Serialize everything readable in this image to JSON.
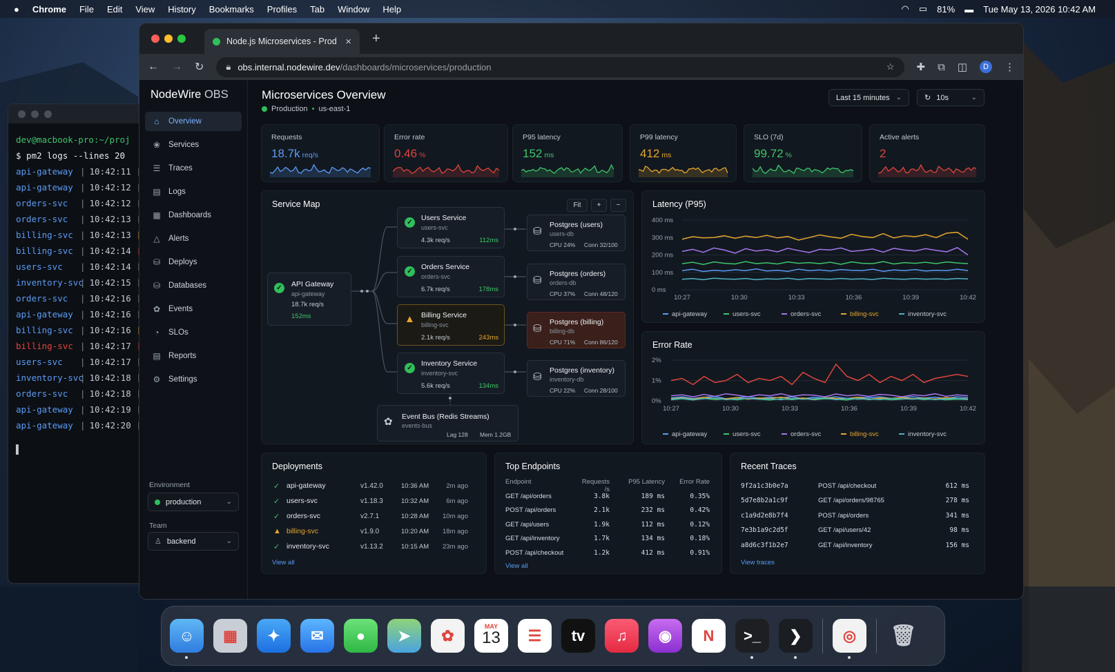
{
  "menubar": {
    "apple": "",
    "app": "Chrome",
    "items": [
      "File",
      "Edit",
      "View",
      "History",
      "Bookmarks",
      "Profiles",
      "Tab",
      "Window",
      "Help"
    ],
    "battery": "81%",
    "datetime": "Tue May 13, 2026  10:42 AM"
  },
  "terminal": {
    "prompt": "dev@macbook-pro:~/proj",
    "command": "$ pm2 logs --lines 20",
    "lines": [
      {
        "svc": "api-gateway",
        "time": "10:42:11",
        "level": "[info",
        "color": "#5b9cf5",
        "lc": "#9aa3ae"
      },
      {
        "svc": "api-gateway",
        "time": "10:42:12",
        "level": "[info",
        "color": "#5b9cf5",
        "lc": "#9aa3ae"
      },
      {
        "svc": "orders-svc",
        "time": "10:42:12",
        "level": "[info",
        "color": "#5b9cf5",
        "lc": "#9aa3ae"
      },
      {
        "svc": "orders-svc",
        "time": "10:42:13",
        "level": "[info",
        "color": "#5b9cf5",
        "lc": "#9aa3ae"
      },
      {
        "svc": "billing-svc",
        "time": "10:42:13",
        "level": "[warn",
        "color": "#5b9cf5",
        "lc": "#e5a72e"
      },
      {
        "svc": "billing-svc",
        "time": "10:42:14",
        "level": "[erro",
        "color": "#5b9cf5",
        "lc": "#e0453d"
      },
      {
        "svc": "users-svc",
        "time": "10:42:14",
        "level": "[info",
        "color": "#5b9cf5",
        "lc": "#9aa3ae"
      },
      {
        "svc": "inventory-svc",
        "time": "10:42:15",
        "level": "[info",
        "color": "#5b9cf5",
        "lc": "#9aa3ae"
      },
      {
        "svc": "orders-svc",
        "time": "10:42:16",
        "level": "[info",
        "color": "#5b9cf5",
        "lc": "#9aa3ae"
      },
      {
        "svc": "api-gateway",
        "time": "10:42:16",
        "level": "[info",
        "color": "#5b9cf5",
        "lc": "#9aa3ae"
      },
      {
        "svc": "billing-svc",
        "time": "10:42:16",
        "level": "[warn",
        "color": "#5b9cf5",
        "lc": "#e5a72e"
      },
      {
        "svc": "billing-svc",
        "time": "10:42:17",
        "level": "[erro",
        "color": "#e0453d",
        "lc": "#e0453d"
      },
      {
        "svc": "users-svc",
        "time": "10:42:17",
        "level": "[info",
        "color": "#5b9cf5",
        "lc": "#9aa3ae"
      },
      {
        "svc": "inventory-svc",
        "time": "10:42:18",
        "level": "[info",
        "color": "#5b9cf5",
        "lc": "#9aa3ae"
      },
      {
        "svc": "orders-svc",
        "time": "10:42:18",
        "level": "[info",
        "color": "#5b9cf5",
        "lc": "#9aa3ae"
      },
      {
        "svc": "api-gateway",
        "time": "10:42:19",
        "level": "[info",
        "color": "#5b9cf5",
        "lc": "#9aa3ae"
      },
      {
        "svc": "api-gateway",
        "time": "10:42:20",
        "level": "[info",
        "color": "#5b9cf5",
        "lc": "#9aa3ae"
      }
    ],
    "cursor": "▌"
  },
  "browser": {
    "tab_title": "Node.js Microservices - Prod",
    "url_host": "obs.internal.nodewire.dev",
    "url_path": "/dashboards/microservices/production",
    "avatar": "D"
  },
  "sidebar": {
    "brand_a": "NodeWire",
    "brand_b": " OBS",
    "items": [
      {
        "label": "Overview",
        "icon": "⌂"
      },
      {
        "label": "Services",
        "icon": "❀"
      },
      {
        "label": "Traces",
        "icon": "☰"
      },
      {
        "label": "Logs",
        "icon": "▤"
      },
      {
        "label": "Dashboards",
        "icon": "▦"
      },
      {
        "label": "Alerts",
        "icon": "△"
      },
      {
        "label": "Deploys",
        "icon": "⛁"
      },
      {
        "label": "Databases",
        "icon": "⛁"
      },
      {
        "label": "Events",
        "icon": "✿"
      },
      {
        "label": "SLOs",
        "icon": "◔"
      },
      {
        "label": "Reports",
        "icon": "▤"
      },
      {
        "label": "Settings",
        "icon": "⚙"
      }
    ],
    "env_label": "Environment",
    "env_value": "production",
    "team_label": "Team",
    "team_value": "backend"
  },
  "header": {
    "title": "Microservices Overview",
    "env": "Production",
    "region": "us-east-1",
    "range": "Last 15 minutes",
    "refresh": "10s"
  },
  "kpis": [
    {
      "label": "Requests",
      "value": "18.7k",
      "unit": "req/s",
      "color": "#5b9cf5"
    },
    {
      "label": "Error rate",
      "value": "0.46",
      "unit": "%",
      "color": "#e0453d"
    },
    {
      "label": "P95 latency",
      "value": "152",
      "unit": "ms",
      "color": "#3fc56a"
    },
    {
      "label": "P99 latency",
      "value": "412",
      "unit": "ms",
      "color": "#e5a72e"
    },
    {
      "label": "SLO (7d)",
      "value": "99.72",
      "unit": "%",
      "color": "#3fc56a"
    },
    {
      "label": "Active alerts",
      "value": "2",
      "unit": "",
      "color": "#e0453d"
    }
  ],
  "service_map": {
    "title": "Service Map",
    "fit": "Fit",
    "zoom_in": "+",
    "zoom_out": "−",
    "gateway": {
      "name": "API Gateway",
      "id": "api-gateway",
      "rps": "18.7k req/s",
      "lat": "152ms"
    },
    "services": [
      {
        "name": "Users Service",
        "id": "users-svc",
        "rps": "4.3k req/s",
        "lat": "112ms",
        "status": "ok"
      },
      {
        "name": "Orders Service",
        "id": "orders-svc",
        "rps": "6.7k req/s",
        "lat": "178ms",
        "status": "ok"
      },
      {
        "name": "Billing Service",
        "id": "billing-svc",
        "rps": "2.1k req/s",
        "lat": "243ms",
        "status": "warn"
      },
      {
        "name": "Inventory Service",
        "id": "inventory-svc",
        "rps": "5.6k req/s",
        "lat": "134ms",
        "status": "ok"
      }
    ],
    "dbs": [
      {
        "name": "Postgres (users)",
        "id": "users-db",
        "cpu": "CPU 24%",
        "conn": "Conn 32/100"
      },
      {
        "name": "Postgres (orders)",
        "id": "orders-db",
        "cpu": "CPU 37%",
        "conn": "Conn 48/120"
      },
      {
        "name": "Postgres (billing)",
        "id": "billing-db",
        "cpu": "CPU 71%",
        "conn": "Conn 86/120"
      },
      {
        "name": "Postgres (inventory)",
        "id": "inventory-db",
        "cpu": "CPU 22%",
        "conn": "Conn 28/100"
      }
    ],
    "bus": {
      "name": "Event Bus (Redis Streams)",
      "id": "events-bus",
      "lag": "Lag 128",
      "mem": "Mem 1.2GB"
    }
  },
  "chart_data": [
    {
      "type": "line",
      "title": "Latency (P95)",
      "x": [
        "10:27",
        "10:30",
        "10:33",
        "10:36",
        "10:39",
        "10:42"
      ],
      "yticks": [
        "400 ms",
        "300 ms",
        "200 ms",
        "100 ms",
        "0 ms"
      ],
      "ylim": [
        0,
        400
      ],
      "series": [
        {
          "name": "api-gateway",
          "color": "#5b9cf5",
          "values": [
            110,
            118,
            105,
            112,
            108,
            115,
            110,
            120,
            108,
            112,
            106,
            118,
            110,
            114,
            108,
            116,
            112,
            110,
            118,
            106,
            114,
            110,
            116,
            108,
            112,
            110,
            118,
            110
          ]
        },
        {
          "name": "users-svc",
          "color": "#3fc56a",
          "values": [
            150,
            158,
            145,
            160,
            152,
            148,
            162,
            150,
            155,
            148,
            160,
            152,
            156,
            150,
            158,
            146,
            160,
            152,
            150,
            162,
            148,
            156,
            152,
            158,
            150,
            160,
            154,
            150
          ]
        },
        {
          "name": "orders-svc",
          "color": "#a678f0",
          "values": [
            220,
            232,
            215,
            240,
            228,
            210,
            236,
            222,
            230,
            218,
            238,
            225,
            214,
            232,
            228,
            240,
            220,
            226,
            234,
            216,
            238,
            228,
            222,
            236,
            226,
            218,
            242,
            200
          ]
        },
        {
          "name": "billing-svc",
          "color": "#e5a72e",
          "values": [
            290,
            305,
            298,
            300,
            310,
            296,
            308,
            300,
            312,
            298,
            306,
            285,
            300,
            315,
            304,
            296,
            318,
            306,
            300,
            322,
            298,
            310,
            305,
            316,
            300,
            325,
            330,
            290
          ]
        },
        {
          "name": "inventory-svc",
          "color": "#4fb3c8",
          "values": [
            60,
            64,
            58,
            66,
            62,
            60,
            65,
            58,
            63,
            61,
            66,
            59,
            64,
            62,
            60,
            65,
            61,
            63,
            59,
            66,
            62,
            60,
            64,
            61,
            63,
            60,
            65,
            62
          ]
        }
      ]
    },
    {
      "type": "line",
      "title": "Error Rate",
      "x": [
        "10:27",
        "10:30",
        "10:33",
        "10:36",
        "10:39",
        "10:42"
      ],
      "yticks": [
        "2%",
        "1%",
        "0%"
      ],
      "ylim": [
        0,
        2
      ],
      "series": [
        {
          "name": "api-gateway",
          "color": "#5b9cf5",
          "values": [
            0.15,
            0.2,
            0.12,
            0.18,
            0.22,
            0.1,
            0.16,
            0.2,
            0.12,
            0.18,
            0.15,
            0.2,
            0.1,
            0.18,
            0.14,
            0.2,
            0.12,
            0.18,
            0.16,
            0.2,
            0.12,
            0.16,
            0.2,
            0.14,
            0.18,
            0.12,
            0.2,
            0.16
          ]
        },
        {
          "name": "users-svc",
          "color": "#3fc56a",
          "values": [
            0.05,
            0.1,
            0.04,
            0.12,
            0.06,
            0.1,
            0.05,
            0.12,
            0.08,
            0.04,
            0.1,
            0.06,
            0.12,
            0.05,
            0.1,
            0.08,
            0.04,
            0.12,
            0.06,
            0.1,
            0.05,
            0.08,
            0.12,
            0.06,
            0.1,
            0.05,
            0.08,
            0.06
          ]
        },
        {
          "name": "orders-svc",
          "color": "#a678f0",
          "values": [
            0.25,
            0.3,
            0.2,
            0.32,
            0.22,
            0.35,
            0.28,
            0.2,
            0.3,
            0.25,
            0.35,
            0.22,
            0.3,
            0.28,
            0.2,
            0.34,
            0.25,
            0.3,
            0.22,
            0.32,
            0.28,
            0.2,
            0.3,
            0.25,
            0.35,
            0.22,
            0.3,
            0.25
          ]
        },
        {
          "name": "billing-svc",
          "color": "#e5a72e",
          "values": [
            0.1,
            0.15,
            0.08,
            0.18,
            0.12,
            0.1,
            0.16,
            0.08,
            0.14,
            0.12,
            0.18,
            0.1,
            0.14,
            0.08,
            0.16,
            0.12,
            0.1,
            0.18,
            0.08,
            0.14,
            0.12,
            0.16,
            0.1,
            0.14,
            0.08,
            0.16,
            0.12,
            0.1
          ]
        },
        {
          "name": "total",
          "color": "#e0453d",
          "values": [
            1.0,
            1.1,
            0.8,
            1.2,
            0.9,
            1.0,
            1.3,
            0.9,
            1.1,
            1.0,
            1.2,
            0.8,
            1.4,
            1.1,
            0.9,
            1.8,
            1.2,
            1.0,
            1.3,
            0.9,
            1.2,
            1.0,
            1.3,
            0.9,
            1.1,
            1.2,
            1.3,
            1.2
          ]
        },
        {
          "name": "inventory-svc",
          "color": "#4fb3c8",
          "values": [
            0.08,
            0.12,
            0.06,
            0.1,
            0.14,
            0.06,
            0.1,
            0.12,
            0.08,
            0.1,
            0.06,
            0.12,
            0.08,
            0.1,
            0.14,
            0.06,
            0.12,
            0.08,
            0.1,
            0.06,
            0.12,
            0.1,
            0.08,
            0.12,
            0.06,
            0.1,
            0.12,
            0.08
          ]
        }
      ]
    }
  ],
  "legend": [
    "api-gateway",
    "users-svc",
    "orders-svc",
    "billing-svc",
    "inventory-svc"
  ],
  "deployments": {
    "title": "Deployments",
    "view_all": "View all",
    "rows": [
      {
        "svc": "api-gateway",
        "ver": "v1.42.0",
        "time": "10:36 AM",
        "ago": "2m ago",
        "status": "ok"
      },
      {
        "svc": "users-svc",
        "ver": "v1.18.3",
        "time": "10:32 AM",
        "ago": "6m ago",
        "status": "ok"
      },
      {
        "svc": "orders-svc",
        "ver": "v2.7.1",
        "time": "10:28 AM",
        "ago": "10m ago",
        "status": "ok"
      },
      {
        "svc": "billing-svc",
        "ver": "v1.9.0",
        "time": "10:20 AM",
        "ago": "18m ago",
        "status": "warn"
      },
      {
        "svc": "inventory-svc",
        "ver": "v1.13.2",
        "time": "10:15 AM",
        "ago": "23m ago",
        "status": "ok"
      }
    ]
  },
  "endpoints": {
    "title": "Top Endpoints",
    "view_all": "View all",
    "headers": [
      "Endpoint",
      "Requests /s",
      "P95 Latency",
      "Error Rate"
    ],
    "rows": [
      {
        "ep": "GET /api/orders",
        "rps": "3.8k",
        "p95": "189 ms",
        "err": "0.35%"
      },
      {
        "ep": "POST /api/orders",
        "rps": "2.1k",
        "p95": "232 ms",
        "err": "0.42%"
      },
      {
        "ep": "GET /api/users",
        "rps": "1.9k",
        "p95": "112 ms",
        "err": "0.12%"
      },
      {
        "ep": "GET /api/inventory",
        "rps": "1.7k",
        "p95": "134 ms",
        "err": "0.18%"
      },
      {
        "ep": "POST /api/checkout",
        "rps": "1.2k",
        "p95": "412 ms",
        "err": "0.91%"
      }
    ]
  },
  "traces": {
    "title": "Recent Traces",
    "view": "View traces",
    "rows": [
      {
        "id": "9f2a1c3b0e7a",
        "ep": "POST /api/checkout",
        "dur": "612 ms"
      },
      {
        "id": "5d7e8b2a1c9f",
        "ep": "GET /api/orders/98765",
        "dur": "278 ms"
      },
      {
        "id": "c1a9d2e8b7f4",
        "ep": "POST /api/orders",
        "dur": "341 ms"
      },
      {
        "id": "7e3b1a9c2d5f",
        "ep": "GET /api/users/42",
        "dur": "98 ms"
      },
      {
        "id": "a8d6c3f1b2e7",
        "ep": "GET /api/inventory",
        "dur": "156 ms"
      }
    ]
  },
  "dock": {
    "calendar_month": "MAY",
    "calendar_day": "13",
    "apps": [
      {
        "name": "finder",
        "bg": "linear-gradient(#5fb8f5,#2f7ce0)",
        "glyph": "☺"
      },
      {
        "name": "launchpad",
        "bg": "#c9ced6",
        "glyph": "▦"
      },
      {
        "name": "safari",
        "bg": "linear-gradient(#4aa8f5,#1c6fe0)",
        "glyph": "✦"
      },
      {
        "name": "mail",
        "bg": "linear-gradient(#5cb6ff,#2773e6)",
        "glyph": "✉"
      },
      {
        "name": "messages",
        "bg": "linear-gradient(#6ce27a,#2fb845)",
        "glyph": "●"
      },
      {
        "name": "maps",
        "bg": "linear-gradient(#8fd37a,#4aa3e0)",
        "glyph": "➤"
      },
      {
        "name": "photos",
        "bg": "#f3f3f3",
        "glyph": "✿"
      },
      {
        "name": "calendar",
        "bg": "#ffffff",
        "glyph": ""
      },
      {
        "name": "reminders",
        "bg": "#ffffff",
        "glyph": "☰"
      },
      {
        "name": "tv",
        "bg": "#111",
        "glyph": "tv"
      },
      {
        "name": "music",
        "bg": "linear-gradient(#fb5c74,#e42a43)",
        "glyph": "♫"
      },
      {
        "name": "podcasts",
        "bg": "linear-gradient(#c86cf0,#8a2fd0)",
        "glyph": "◉"
      },
      {
        "name": "news",
        "bg": "#fff",
        "glyph": "N"
      },
      {
        "name": "terminal",
        "bg": "#1d1f22",
        "glyph": ">_"
      },
      {
        "name": "vscode",
        "bg": "#1a1d22",
        "glyph": "❯"
      },
      {
        "name": "chrome",
        "bg": "#f2f2f2",
        "glyph": "◎"
      },
      {
        "name": "trash",
        "bg": "transparent",
        "glyph": "🗑"
      }
    ]
  }
}
